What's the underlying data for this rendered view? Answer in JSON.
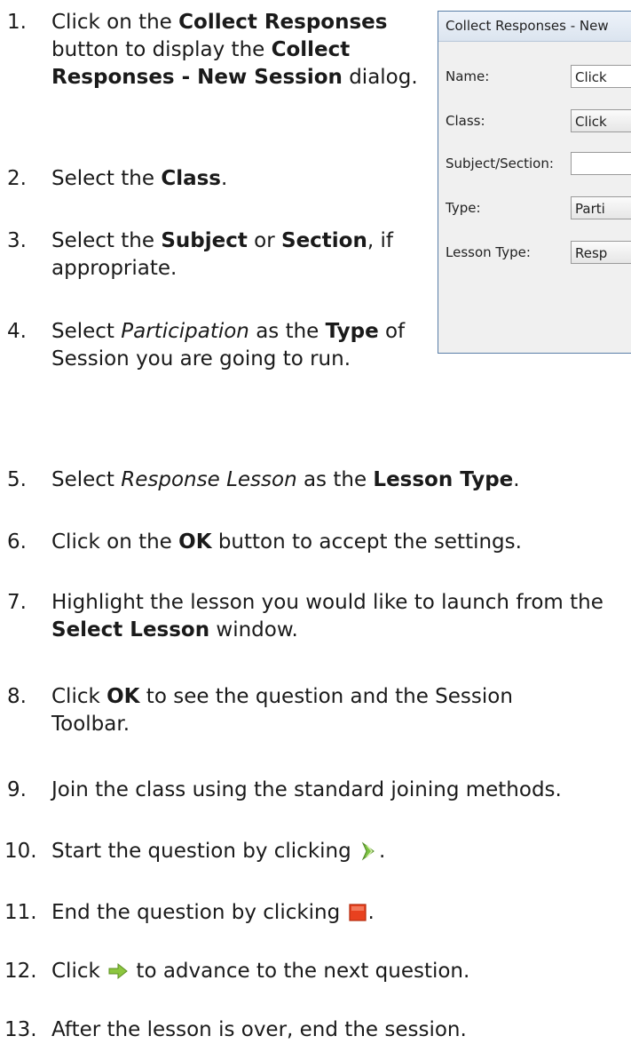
{
  "steps": [
    {
      "num": "1.",
      "parts": [
        "Click on the ",
        "Collect Responses",
        " button to display the ",
        "Collect Responses - New Session",
        " dialog."
      ]
    },
    {
      "num": "2.",
      "parts": [
        "Select the ",
        "Class",
        "."
      ]
    },
    {
      "num": "3.",
      "parts": [
        "Select the ",
        "Subject",
        " or ",
        "Section",
        ", if appropriate."
      ]
    },
    {
      "num": "4.",
      "parts": [
        "Select ",
        "Participation",
        " as the ",
        "Type",
        " of Session you are going to run."
      ]
    },
    {
      "num": "5.",
      "parts": [
        "Select ",
        "Response Lesson",
        " as the ",
        "Lesson Type",
        "."
      ]
    },
    {
      "num": "6.",
      "parts": [
        "Click on the ",
        "OK",
        " button to accept the settings."
      ]
    },
    {
      "num": "7.",
      "parts": [
        "Highlight the lesson you would like to launch from the ",
        "Select Lesson",
        " window."
      ]
    },
    {
      "num": "8.",
      "parts": [
        "Click ",
        "OK",
        " to see the question and the Session Toolbar."
      ]
    },
    {
      "num": "9.",
      "parts": [
        "Join the class using the standard joining methods."
      ]
    },
    {
      "num": "10.",
      "parts": [
        "Start the question by clicking ",
        "."
      ]
    },
    {
      "num": "11.",
      "parts": [
        "End the question by clicking ",
        "."
      ]
    },
    {
      "num": "12.",
      "parts": [
        "Click ",
        " to advance to the next question."
      ]
    },
    {
      "num": "13.",
      "parts": [
        "After the lesson is over, end the session."
      ]
    }
  ],
  "dialog": {
    "title": "Collect Responses - New",
    "rows": [
      {
        "label": "Name:",
        "value": "Click"
      },
      {
        "label": "Class:",
        "value": "Click"
      },
      {
        "label": "Subject/Section:",
        "value": ""
      },
      {
        "label": "Type:",
        "value": "Parti"
      },
      {
        "label": "Lesson Type:",
        "value": "Resp"
      }
    ]
  },
  "icons": {
    "start": {
      "name": "start-arrow-icon",
      "color": "#7cc242"
    },
    "stop": {
      "name": "stop-square-icon",
      "color": "#e8411f"
    },
    "next": {
      "name": "next-arrow-icon",
      "color": "#8cc63f"
    }
  }
}
